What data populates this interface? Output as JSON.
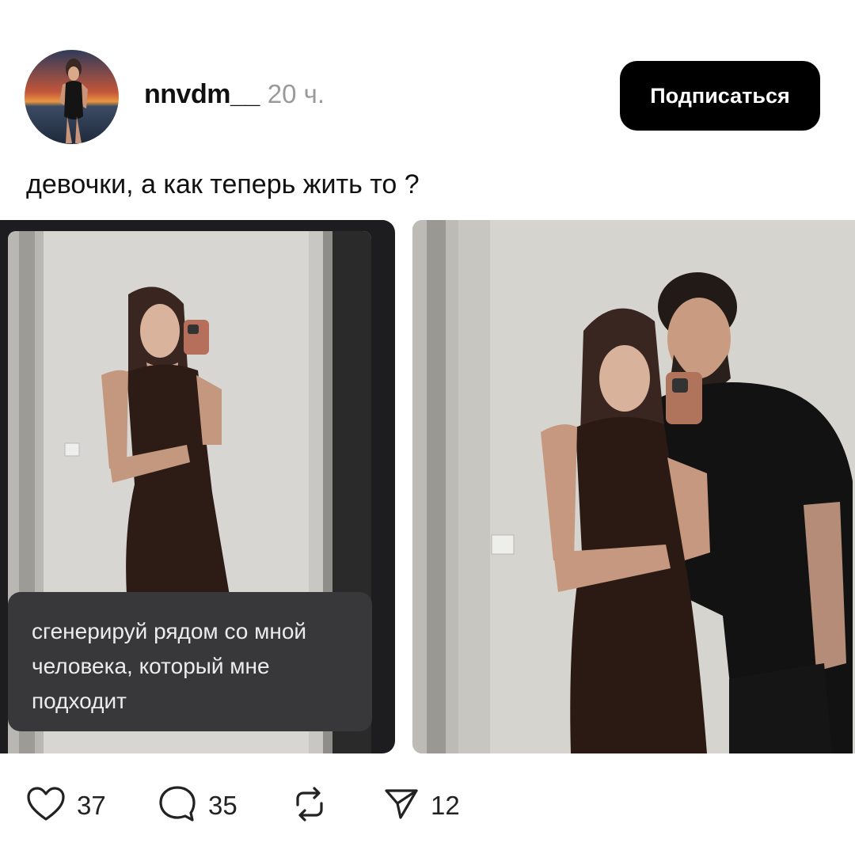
{
  "post": {
    "author": {
      "username": "nnvdm__",
      "time": "20 ч.",
      "avatar_icon": "user-avatar"
    },
    "follow_label": "Подписаться",
    "caption": "девочки, а как теперь жить то ?",
    "media": {
      "prompt_text": "сгенерируй рядом со мной человека, который мне подходит"
    },
    "actions": {
      "likes": "37",
      "comments": "35",
      "shares": "12"
    }
  },
  "colors": {
    "button_bg": "#000000",
    "button_text": "#ffffff",
    "muted_text": "#9a9a9a",
    "dark_panel": "#1d1d1f",
    "prompt_bubble": "#38383a"
  }
}
